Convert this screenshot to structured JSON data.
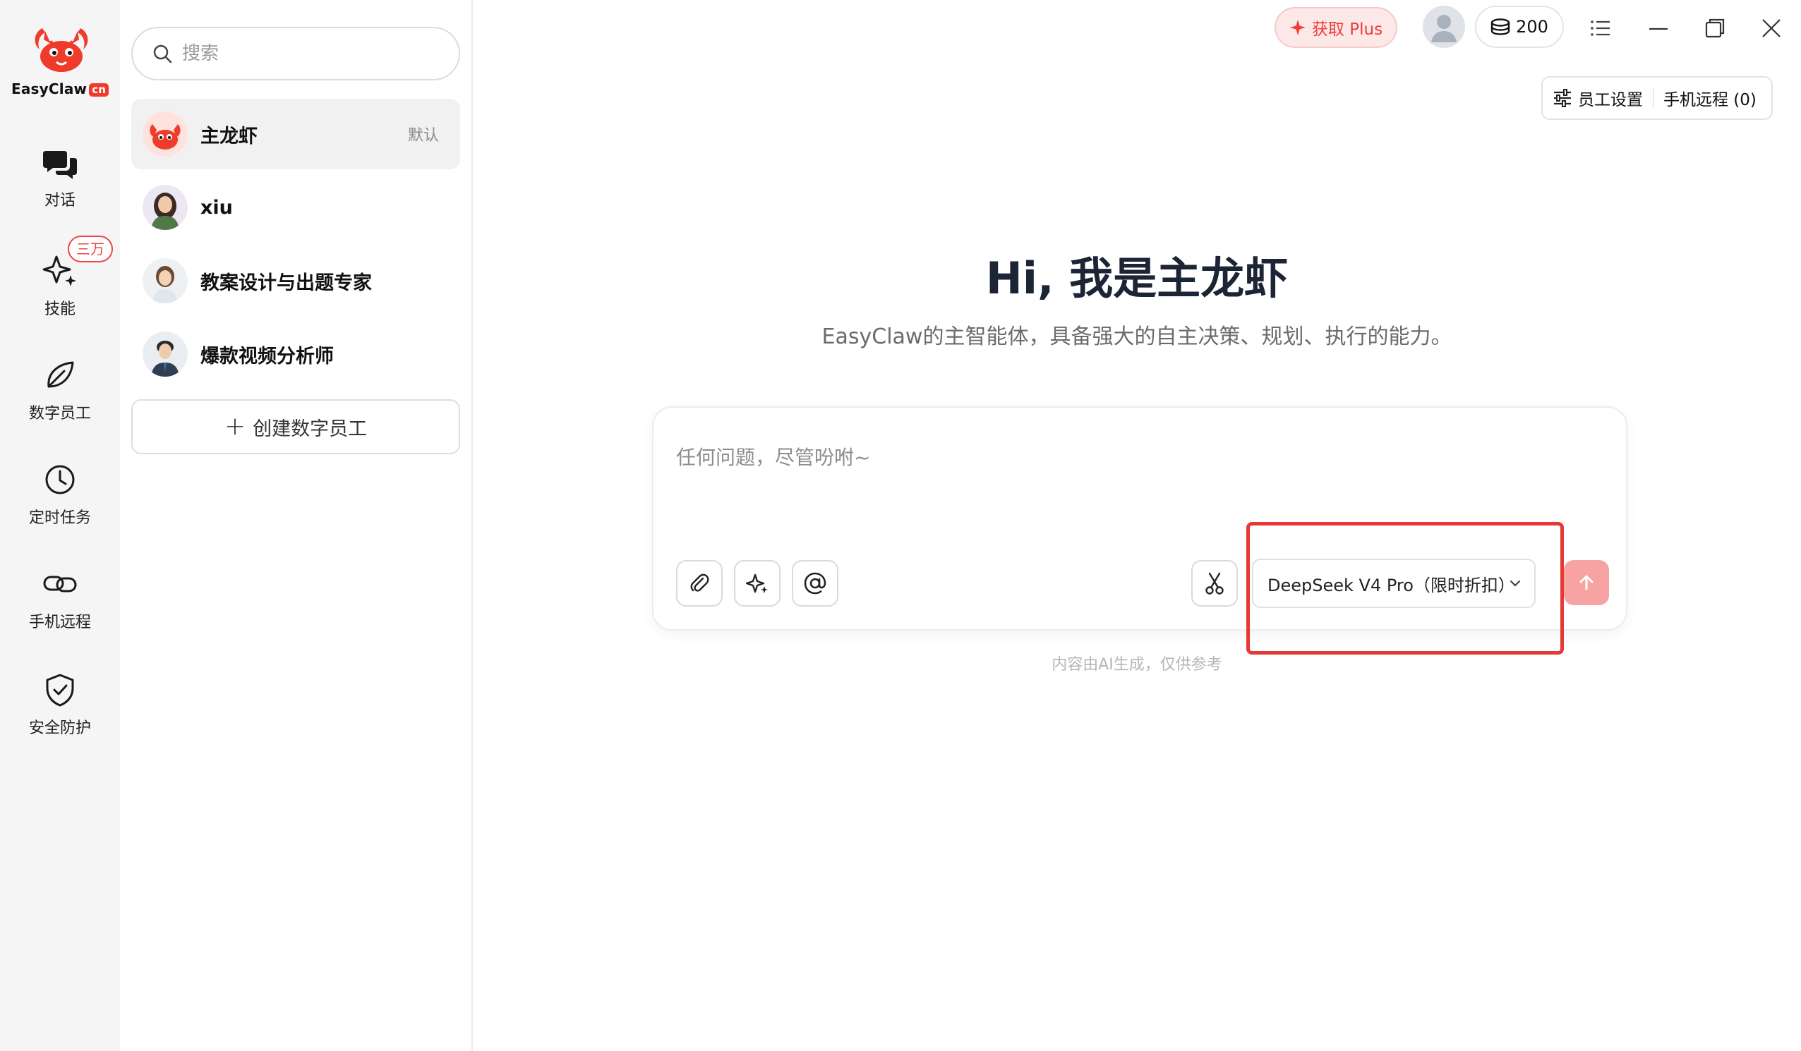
{
  "app": {
    "logo_text": "EasyClaw",
    "logo_badge": "cn"
  },
  "nav": [
    {
      "label": "对话",
      "icon": "chat-icon"
    },
    {
      "label": "技能",
      "icon": "sparkle-icon",
      "badge": "三万"
    },
    {
      "label": "数字员工",
      "icon": "leaf-icon"
    },
    {
      "label": "定时任务",
      "icon": "clock-icon"
    },
    {
      "label": "手机远程",
      "icon": "link-icon"
    },
    {
      "label": "安全防护",
      "icon": "shield-icon"
    }
  ],
  "search": {
    "placeholder": "搜索"
  },
  "agents": [
    {
      "name": "主龙虾",
      "tag": "默认",
      "active": true
    },
    {
      "name": "xiu"
    },
    {
      "name": "教案设计与出题专家"
    },
    {
      "name": "爆款视频分析师"
    }
  ],
  "create_agent_label": "创建数字员工",
  "topbar": {
    "plus_label": "获取 Plus",
    "credits": "200",
    "staff_settings": "员工设置",
    "phone_remote": "手机远程 (0)"
  },
  "hero": {
    "title": "Hi, 我是主龙虾",
    "subtitle": "EasyClaw的主智能体，具备强大的自主决策、规划、执行的能力。"
  },
  "composer": {
    "placeholder": "任何问题，尽管吩咐~",
    "model": "DeepSeek V4 Pro（限时折扣）"
  },
  "disclaimer": "内容由AI生成，仅供参考",
  "colors": {
    "accent": "#ef3b2c",
    "send_disabled": "#f7a3a3",
    "highlight": "#e53935"
  }
}
